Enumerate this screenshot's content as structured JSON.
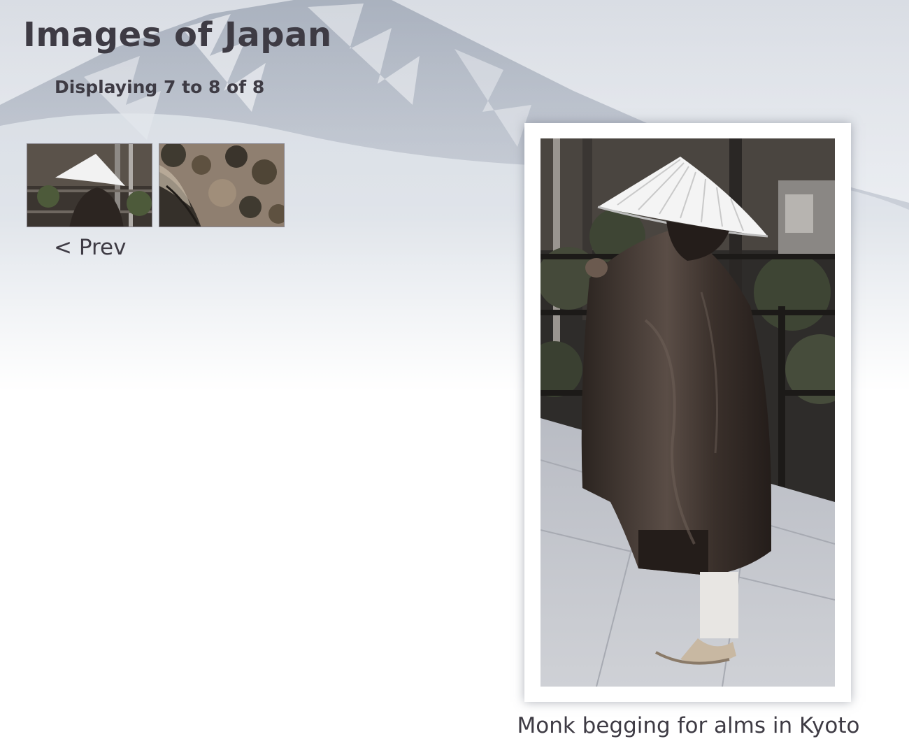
{
  "page": {
    "title": "Images of Japan",
    "status": "Displaying 7 to 8 of 8"
  },
  "thumbnails": [
    {
      "subject": "monk",
      "selected": true
    },
    {
      "subject": "temple-roof",
      "selected": false
    }
  ],
  "pagination": {
    "prev_label": "< Prev"
  },
  "photo": {
    "caption": "Monk begging for alms in Kyoto"
  },
  "colors": {
    "text": "#3e3b44",
    "mist": "#c9ced8",
    "robe": "#4a3f3a",
    "frame": "#ffffff"
  }
}
